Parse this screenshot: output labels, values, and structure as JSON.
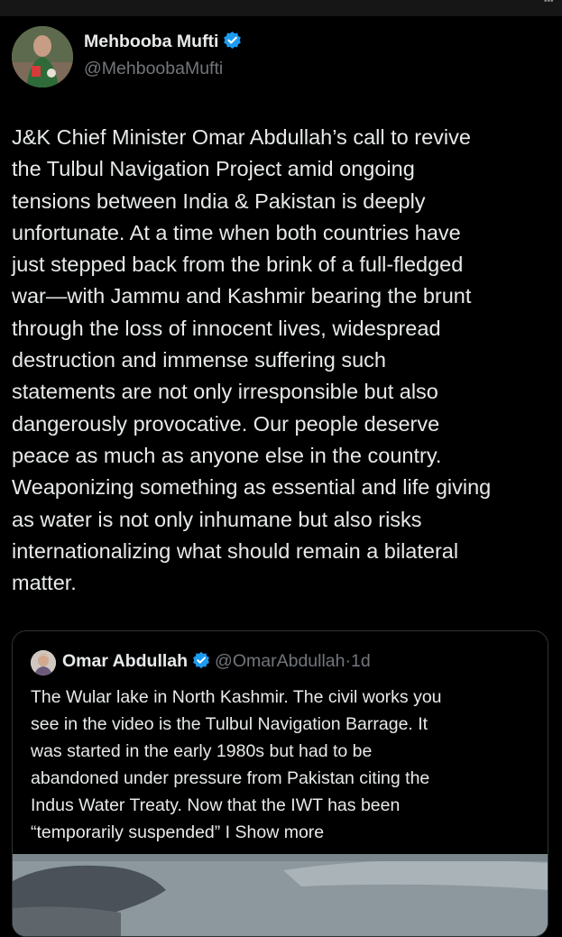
{
  "author": {
    "name": "Mehbooba Mufti",
    "handle": "@MehboobaMufti",
    "verified_icon": "verified-badge-icon",
    "verified_color": "#1d9bf0"
  },
  "tweet": {
    "lines": [
      "J&K Chief Minister Omar Abdullah’s call to revive",
      "the Tulbul Navigation Project amid ongoing",
      "tensions between India & Pakistan is deeply",
      "unfortunate. At a time when both countries have",
      "just stepped back from the brink of a full-fledged",
      "war—with Jammu and Kashmir bearing the brunt",
      "through the loss of innocent lives, widespread",
      "destruction and immense suffering such",
      "statements are not only irresponsible but also",
      "dangerously provocative. Our people deserve",
      "peace as much as anyone else in the country.",
      "Weaponizing something as essential and life giving",
      "as water is not only inhumane but also risks",
      "internationalizing what should remain a bilateral",
      "matter."
    ]
  },
  "quote": {
    "name": "Omar Abdullah",
    "handle": "@OmarAbdullah",
    "separator": "·",
    "time": "1d",
    "lines": [
      "The Wular lake in North Kashmir. The civil works you",
      "see in the video is the Tulbul Navigation Barrage.  It",
      "was started in the early 1980s but had to be",
      "abandoned under pressure from Pakistan citing the",
      "Indus Water Treaty. Now that the IWT has been",
      "“temporarily suspended” I Show more"
    ]
  },
  "colors": {
    "background": "#000000",
    "text": "#e7e9ea",
    "secondary_text": "#71767b",
    "border": "#2f3336"
  }
}
